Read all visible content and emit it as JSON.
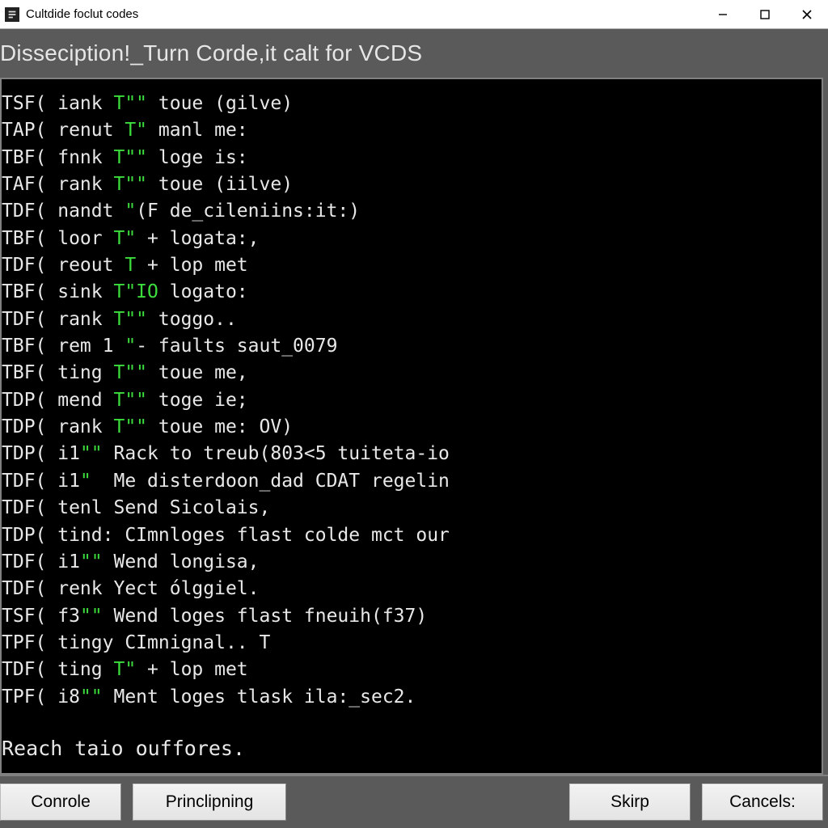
{
  "window": {
    "title": "Cultdide foclut codes"
  },
  "page": {
    "heading": "Disseciption!_Turn Corde,it calt for VCDS"
  },
  "terminal": {
    "lines": [
      {
        "prefix": "TSF( iank ",
        "green": "T\"\"",
        "rest": " toue (gilve)"
      },
      {
        "prefix": "TAP( renut ",
        "green": "T\"",
        "rest": " manl me:"
      },
      {
        "prefix": "TBF( fnnk ",
        "green": "T\"\"",
        "rest": " loge is:"
      },
      {
        "prefix": "TAF( rank ",
        "green": "T\"\"",
        "rest": " toue (iilve)"
      },
      {
        "prefix": "TDF( nandt ",
        "green": "\"",
        "rest": "(F de_cileniins:it:)"
      },
      {
        "prefix": "TBF( loor ",
        "green": "T\"",
        "rest": " + logata:,"
      },
      {
        "prefix": "TDF( reout ",
        "green": "T",
        "rest": " + lop met"
      },
      {
        "prefix": "TBF( sink ",
        "green": "T\"IO",
        "rest": " logato:"
      },
      {
        "prefix": "TDF( rank ",
        "green": "T\"\"",
        "rest": " toggo.."
      },
      {
        "prefix": "TBF( rem 1 ",
        "green": "\"",
        "rest": "- faults saut_0079"
      },
      {
        "prefix": "TBF( ting ",
        "green": "T\"\"",
        "rest": " toue me,"
      },
      {
        "prefix": "TDP( mend ",
        "green": "T\"\"",
        "rest": " toge ie;"
      },
      {
        "prefix": "TDP( rank ",
        "green": "T\"\"",
        "rest": " toue me: OV)"
      },
      {
        "prefix": "TDP( i1",
        "green": "\"\"",
        "rest": " Rack to treub(803<5 tuiteta-io"
      },
      {
        "prefix": "TDF( i1",
        "green": "\"",
        "rest": "  Me disterdoon_dad CDAT regelin"
      },
      {
        "prefix": "TDF( tenl ",
        "green": "",
        "rest": "Send Sicolais,"
      },
      {
        "prefix": "TDP( tind: ",
        "green": "",
        "rest": "CImnloges flast colde mct our"
      },
      {
        "prefix": "TDF( i1",
        "green": "\"\"",
        "rest": " Wend longisa,"
      },
      {
        "prefix": "TDF( renk ",
        "green": "",
        "rest": "Yect ólggiel."
      },
      {
        "prefix": "TSF( f3",
        "green": "\"\"",
        "rest": " Wend loges flast fneuih(f37)"
      },
      {
        "prefix": "TPF( tingy ",
        "green": "",
        "rest": "CImnignal.. T"
      },
      {
        "prefix": "TDF( ting ",
        "green": "T\"",
        "rest": " + lop met"
      },
      {
        "prefix": "TPF( i8",
        "green": "\"\"",
        "rest": " Ment loges tlask ila:_sec2."
      }
    ],
    "footer": "Reach taio ouffores."
  },
  "buttons": {
    "conrole": "Conrole",
    "princlipning": "Princlipning",
    "skirp": "Skirp",
    "cancels": "Cancels:"
  }
}
